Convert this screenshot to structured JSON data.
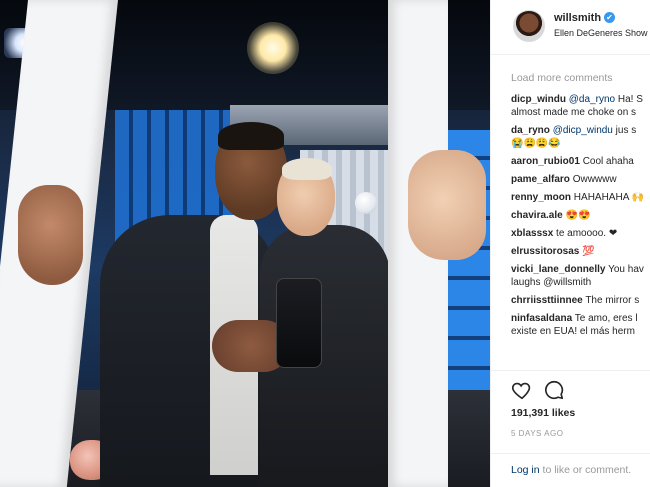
{
  "post": {
    "username": "willsmith",
    "verified_badge": "✔",
    "location": "Ellen DeGeneres Show"
  },
  "load_more_label": "Load more comments",
  "comments": [
    {
      "user": "dicp_windu",
      "mention": "@da_ryno",
      "text": "Ha! S",
      "line2": "almost made me choke on s"
    },
    {
      "user": "da_ryno",
      "mention": "@dicp_windu",
      "text": "jus s",
      "line2": "😭😩😩😂"
    },
    {
      "user": "aaron_rubio01",
      "mention": "",
      "text": "Cool ahaha",
      "line2": ""
    },
    {
      "user": "pame_alfaro",
      "mention": "",
      "text": "Owwwww",
      "line2": ""
    },
    {
      "user": "renny_moon",
      "mention": "",
      "text": "HAHAHAHA 🙌",
      "line2": ""
    },
    {
      "user": "chavira.ale",
      "mention": "",
      "text": "😍😍",
      "line2": ""
    },
    {
      "user": "xblasssx",
      "mention": "",
      "text": "te amoooo. ❤",
      "line2": ""
    },
    {
      "user": "elrussitorosas",
      "mention": "",
      "text": "💯",
      "line2": ""
    },
    {
      "user": "vicki_lane_donnelly",
      "mention": "",
      "text": "You hav",
      "line2": "laughs @willsmith"
    },
    {
      "user": "chrriissttiinnee",
      "mention": "",
      "text": "The mirror s",
      "line2": ""
    },
    {
      "user": "ninfasaldana",
      "mention": "",
      "text": "Te amo, eres l",
      "line2": "existe en EUA! el más herm"
    }
  ],
  "likes": "191,391 likes",
  "time_ago": "5 DAYS AGO",
  "login": {
    "link": "Log in",
    "rest": " to like or comment."
  },
  "icons": {
    "like": "heart-icon",
    "comment": "comment-icon"
  }
}
